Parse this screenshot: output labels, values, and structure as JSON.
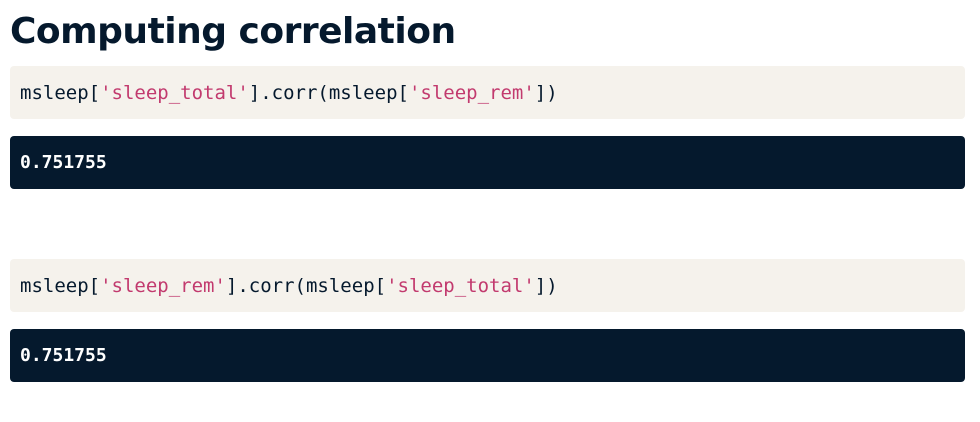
{
  "title": "Computing correlation",
  "cells": [
    {
      "code": {
        "prefix": "msleep[",
        "arg1": "'sleep_total'",
        "middle": "].corr(msleep[",
        "arg2": "'sleep_rem'",
        "suffix": "])"
      },
      "output": "0.751755"
    },
    {
      "code": {
        "prefix": "msleep[",
        "arg1": "'sleep_rem'",
        "middle": "].corr(msleep[",
        "arg2": "'sleep_total'",
        "suffix": "])"
      },
      "output": "0.751755"
    }
  ],
  "colors": {
    "title": "#05192d",
    "code_background": "#f5f2ec",
    "string_literal": "#c23a6e",
    "output_background": "#05192d",
    "output_text": "#ffffff"
  }
}
